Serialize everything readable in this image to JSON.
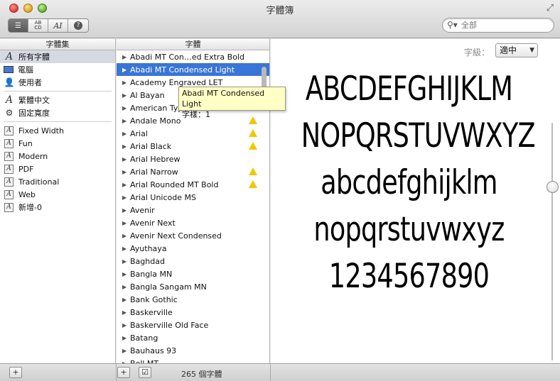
{
  "window": {
    "title": "字體簿"
  },
  "toolbar": {
    "view_buttons": [
      {
        "name": "list-view-icon",
        "glyph": "☰"
      },
      {
        "name": "abcd-view-icon",
        "glyph": "AB CD"
      },
      {
        "name": "font-info-icon",
        "glyph": "AI"
      },
      {
        "name": "help-icon",
        "glyph": "?"
      }
    ],
    "search_placeholder": "全部"
  },
  "left_column": {
    "header": "字體集",
    "top_items": [
      {
        "label": "所有字體",
        "icon": "all-fonts-icon",
        "selected": true
      },
      {
        "label": "電腦",
        "icon": "computer-icon"
      },
      {
        "label": "使用者",
        "icon": "user-icon"
      }
    ],
    "lang_items": [
      {
        "label": "繁體中文",
        "icon": "font-icon"
      },
      {
        "label": "固定寬度",
        "icon": "gear-icon"
      }
    ],
    "collections": [
      "Fixed Width",
      "Fun",
      "Modern",
      "PDF",
      "Traditional",
      "Web",
      "新增-0"
    ]
  },
  "middle_column": {
    "header": "字體",
    "fonts": [
      {
        "name": "Abadi MT Con…ed Extra Bold"
      },
      {
        "name": "Abadi MT Condensed Light",
        "selected": true
      },
      {
        "name": "Academy Engraved LET"
      },
      {
        "name": "Al Bayan"
      },
      {
        "name": "American Typewriter"
      },
      {
        "name": "Andale Mono",
        "warning": true
      },
      {
        "name": "Arial",
        "warning": true
      },
      {
        "name": "Arial Black",
        "warning": true
      },
      {
        "name": "Arial Hebrew"
      },
      {
        "name": "Arial Narrow",
        "warning": true
      },
      {
        "name": "Arial Rounded MT Bold",
        "warning": true
      },
      {
        "name": "Arial Unicode MS"
      },
      {
        "name": "Avenir"
      },
      {
        "name": "Avenir Next"
      },
      {
        "name": "Avenir Next Condensed"
      },
      {
        "name": "Ayuthaya"
      },
      {
        "name": "Baghdad"
      },
      {
        "name": "Bangla MN"
      },
      {
        "name": "Bangla Sangam MN"
      },
      {
        "name": "Bank Gothic"
      },
      {
        "name": "Baskerville"
      },
      {
        "name": "Baskerville Old Face"
      },
      {
        "name": "Batang"
      },
      {
        "name": "Bauhaus 93"
      },
      {
        "name": "Bell MT"
      }
    ],
    "tooltip": {
      "line1": "Abadi MT Condensed Light",
      "line2": "字樣：1"
    }
  },
  "preview": {
    "size_label": "字級：",
    "size_value": "適中",
    "lines": [
      "ABCDEFGHIJKLM",
      "NOPQRSTUVWXYZ",
      "abcdefghijklm",
      "nopqrstuvwxyz",
      "1234567890"
    ]
  },
  "bottom": {
    "add_collection": "+",
    "add_font": "+",
    "enable_check": "☑",
    "count_text": "265 個字體"
  }
}
